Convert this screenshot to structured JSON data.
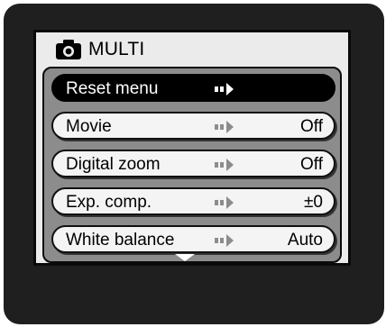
{
  "header": {
    "title": "MULTI",
    "icon": "camera-icon"
  },
  "menu": {
    "items": [
      {
        "label": "Reset menu",
        "value": "",
        "selected": true
      },
      {
        "label": "Movie",
        "value": "Off",
        "selected": false
      },
      {
        "label": "Digital zoom",
        "value": "Off",
        "selected": false
      },
      {
        "label": "Exp. comp.",
        "value": "±0",
        "selected": false
      },
      {
        "label": "White balance",
        "value": "Auto",
        "selected": false
      }
    ],
    "arrow_icon": "submenu-arrow-icon",
    "scroll_icon": "scroll-down-icon"
  },
  "colors": {
    "bezel": "#1f1f1f",
    "screen_background": "#ebebeb",
    "panel": "#8c8c8c",
    "selected_item": "#000000",
    "item": "#f4f4f4"
  }
}
